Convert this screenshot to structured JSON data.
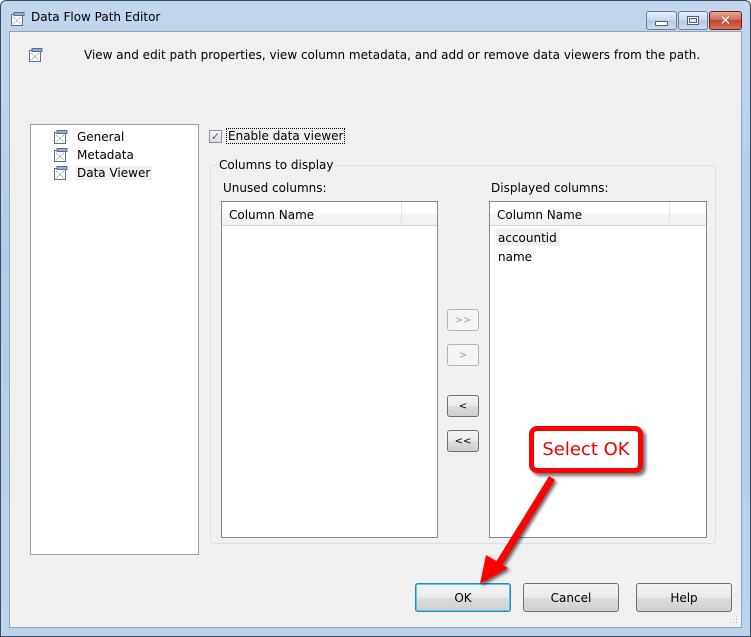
{
  "window": {
    "title": "Data Flow Path Editor",
    "controls": {
      "minimize": "minimize",
      "maximize": "maximize",
      "close": "✕"
    }
  },
  "header": {
    "description": "View and edit path properties, view column metadata, and add or remove data viewers from the path."
  },
  "nav": {
    "items": [
      {
        "label": "General",
        "icon": "page-icon",
        "selected": false
      },
      {
        "label": "Metadata",
        "icon": "page-icon",
        "selected": false
      },
      {
        "label": "Data Viewer",
        "icon": "page-icon",
        "selected": true
      }
    ]
  },
  "data_viewer": {
    "enable_checkbox": {
      "label": "Enable data viewer",
      "checked": true,
      "checkmark": "✓"
    },
    "group_title": "Columns to display",
    "unused": {
      "label": "Unused columns:",
      "column_header": "Column Name",
      "rows": []
    },
    "displayed": {
      "label": "Displayed columns:",
      "column_header": "Column Name",
      "rows": [
        "accountid",
        "name"
      ]
    },
    "move_buttons": {
      "add_all": ">>",
      "add": ">",
      "remove": "<",
      "remove_all": "<<"
    }
  },
  "footer": {
    "ok": "OK",
    "cancel": "Cancel",
    "help": "Help"
  },
  "annotation": {
    "callout_text": "Select OK",
    "color": "#ff0000"
  }
}
